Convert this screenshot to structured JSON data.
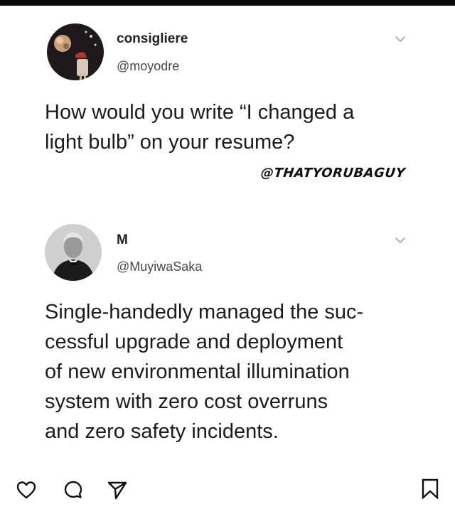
{
  "posts": [
    {
      "display_name": "consigliere",
      "handle": "@moyodre",
      "text_lines": [
        "How would you write “I changed a",
        "light bulb” on your resume?"
      ]
    },
    {
      "display_name": "M",
      "handle": "@MuyiwaSaka",
      "text_lines": [
        "Single-handedly managed the suc-",
        "cessful upgrade and deployment",
        "of new environmental illumination",
        "system with zero cost overruns",
        "and zero safety incidents."
      ]
    }
  ],
  "watermark": "@THATYORUBAGUY",
  "icons": {
    "chevron": "chevron-down-icon",
    "like": "heart-icon",
    "comment": "comment-bubble-icon",
    "share": "paper-plane-icon",
    "save": "bookmark-icon"
  },
  "colors": {
    "background": "#ffffff",
    "text": "#1c1c1c",
    "handle": "#4a4a4a",
    "chevron": "#b0b0b0"
  }
}
